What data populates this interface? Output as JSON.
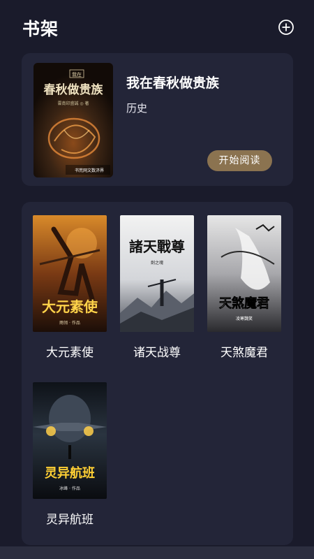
{
  "header": {
    "title": "书架"
  },
  "featured": {
    "title": "我在春秋做贵族",
    "category": "历史",
    "read_button": "开始阅读",
    "cover_text": {
      "top": "我在",
      "main": "春秋做贵族",
      "author": "雲南印盛誠 ◎ 著",
      "publisher": "书荒网文数济界"
    }
  },
  "books": [
    {
      "title": "大元素使",
      "cover_title": "大元素使",
      "cover_author": "雨翎 · 作品"
    },
    {
      "title": "诸天战尊",
      "cover_title": "諸天戰尊",
      "cover_author": "劍之魂"
    },
    {
      "title": "天煞魔君",
      "cover_title": "天煞魔君",
      "cover_author": "凌寒魏笑"
    },
    {
      "title": "灵异航班",
      "cover_title": "灵异航班",
      "cover_author": "冰峰 · 作品"
    }
  ]
}
